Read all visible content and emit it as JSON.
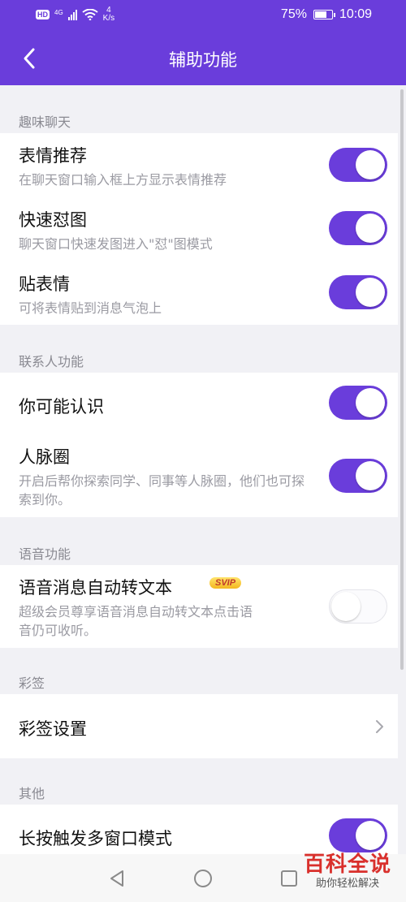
{
  "statusbar": {
    "hd": "HD",
    "network": "4G",
    "speed_value": "4",
    "speed_unit": "K/s",
    "battery_pct": "75%",
    "battery_level": 0.75,
    "time": "10:09"
  },
  "header": {
    "title": "辅助功能",
    "back_icon": "chevron-left-icon"
  },
  "sections": {
    "fun": {
      "header": "趣味聊天",
      "items": [
        {
          "title": "表情推荐",
          "desc": "在聊天窗口输入框上方显示表情推荐",
          "on": true
        },
        {
          "title": "快速怼图",
          "desc": "聊天窗口快速发图进入\"怼\"图模式",
          "on": true
        },
        {
          "title": "贴表情",
          "desc": "可将表情贴到消息气泡上",
          "on": true
        }
      ]
    },
    "contacts": {
      "header": "联系人功能",
      "items": [
        {
          "title": "你可能认识",
          "on": true
        },
        {
          "title": "人脉圈",
          "desc": "开启后帮你探索同学、同事等人脉圈，他们也可探索到你。",
          "on": true
        }
      ]
    },
    "voice": {
      "header": "语音功能",
      "items": [
        {
          "title": "语音消息自动转文本",
          "badge": "SVIP",
          "desc": "超级会员尊享语音消息自动转文本点击语音仍可收听。",
          "on": false
        }
      ]
    },
    "caiqian": {
      "header": "彩签",
      "items": [
        {
          "title": "彩签设置",
          "icon": "chevron-right-icon"
        }
      ]
    },
    "other": {
      "header": "其他",
      "items": [
        {
          "title": "长按触发多窗口模式",
          "on": true
        }
      ]
    }
  },
  "navbar": {
    "back": "triangle-back-icon",
    "home": "circle-home-icon",
    "recents": "square-recents-icon"
  },
  "watermark": {
    "main": "百科全说",
    "sub": "助你轻松解决"
  },
  "colors": {
    "accent": "#6a3ddb",
    "background": "#f1f1f5",
    "toggle_off": "#fbfbfd"
  }
}
